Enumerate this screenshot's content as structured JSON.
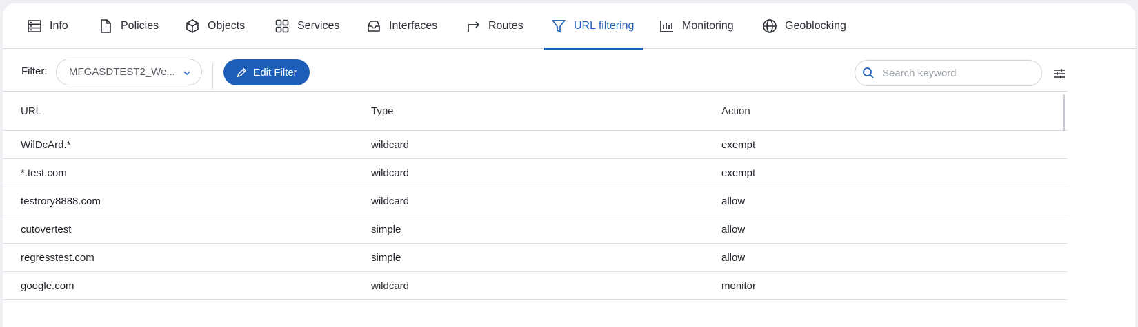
{
  "tabs": [
    {
      "label": "Info",
      "icon": "server-list-icon"
    },
    {
      "label": "Policies",
      "icon": "document-icon"
    },
    {
      "label": "Objects",
      "icon": "cube-icon"
    },
    {
      "label": "Services",
      "icon": "grid-icon"
    },
    {
      "label": "Interfaces",
      "icon": "inbox-icon"
    },
    {
      "label": "Routes",
      "icon": "route-arrow-icon"
    },
    {
      "label": "URL filtering",
      "icon": "funnel-icon",
      "active": true
    },
    {
      "label": "Monitoring",
      "icon": "bar-chart-icon"
    },
    {
      "label": "Geoblocking",
      "icon": "globe-icon"
    }
  ],
  "toolbar": {
    "filter_label": "Filter:",
    "filter_value": "MFGASDTEST2_We...",
    "edit_label": "Edit Filter",
    "search_placeholder": "Search keyword"
  },
  "table": {
    "headers": [
      "URL",
      "Type",
      "Action"
    ],
    "rows": [
      [
        "WilDcArd.*",
        "wildcard",
        "exempt"
      ],
      [
        "*.test.com",
        "wildcard",
        "exempt"
      ],
      [
        "testrory8888.com",
        "wildcard",
        "allow"
      ],
      [
        "cutovertest",
        "simple",
        "allow"
      ],
      [
        "regresstest.com",
        "simple",
        "allow"
      ],
      [
        "google.com",
        "wildcard",
        "monitor"
      ]
    ]
  },
  "colors": {
    "accent": "#1d5fb8",
    "border": "#d7dade"
  }
}
